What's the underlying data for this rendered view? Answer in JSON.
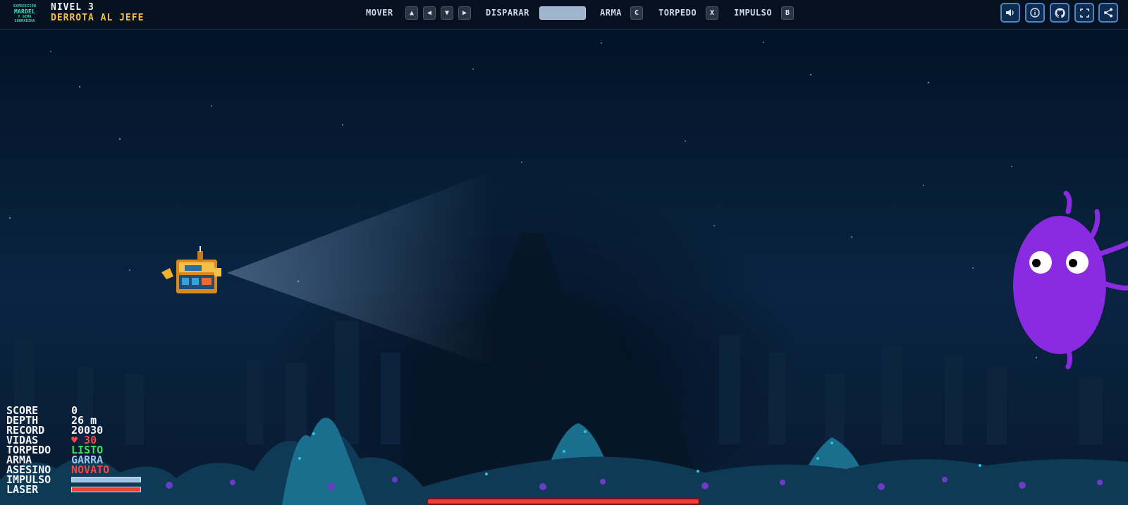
{
  "header": {
    "logo_lines": [
      "EXPEDICIÓN",
      "MARDEL",
      "Y GEMA",
      "SUBMARINA"
    ],
    "level_title": "NIVEL 3",
    "level_goal": "DERROTA AL JEFE"
  },
  "controls": {
    "move_label": "MOVER",
    "move_keys": [
      "▲",
      "◀",
      "▼",
      "▶"
    ],
    "fire_label": "DISPARAR",
    "fire_key": "",
    "weapon_label": "ARMA",
    "weapon_key": "C",
    "torpedo_label": "TORPEDO",
    "torpedo_key": "X",
    "boost_label": "IMPULSO",
    "boost_key": "B"
  },
  "toolbar_icons": [
    "speaker-icon",
    "info-icon",
    "github-icon",
    "fullscreen-icon",
    "share-icon"
  ],
  "hud": {
    "score_label": "SCORE",
    "score_value": "0",
    "depth_label": "DEPTH",
    "depth_value": "26 m",
    "record_label": "RECORD",
    "record_value": "20030",
    "lives_label": "VIDAS",
    "lives_value": "♥ 30",
    "torpedo_label": "TORPEDO",
    "torpedo_value": "LISTO",
    "weapon_label": "ARMA",
    "weapon_value": "GARRA",
    "killer_label": "ASESINO",
    "killer_value": "NOVATO",
    "boost_label": "IMPULSO",
    "boost_level": 1.0,
    "laser_label": "LASER",
    "laser_level": 1.0
  },
  "boss": {
    "health": 1.0
  },
  "colors": {
    "accent": "#4d86c7",
    "goal": "#f4c04a",
    "danger": "#f04848",
    "ready": "#38e25a",
    "boss": "#8a2be2"
  }
}
